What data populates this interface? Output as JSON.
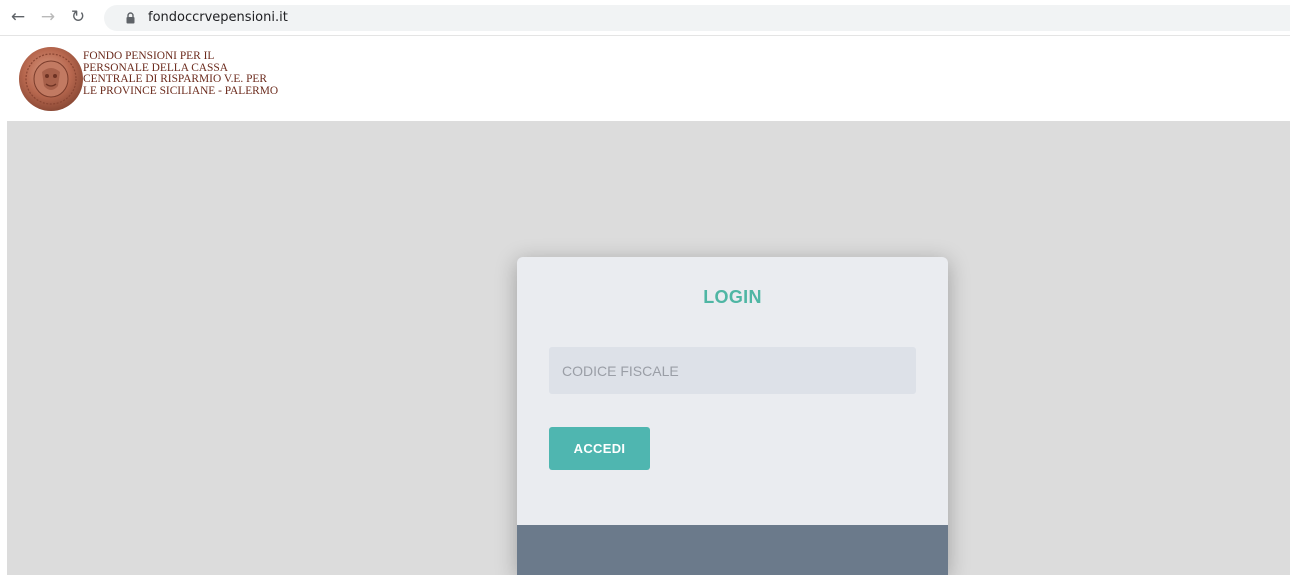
{
  "browser": {
    "url": "fondoccrvepensioni.it",
    "icons": {
      "back": "arrow-left-icon",
      "forward": "arrow-right-icon",
      "reload": "reload-icon",
      "lock": "lock-icon"
    }
  },
  "header": {
    "logo": "seal-logo",
    "org_name_lines": [
      "FONDO PENSIONI  PER IL",
      "PERSONALE DELLA CASSA",
      "CENTRALE DI RISPARMIO V.E. PER",
      "LE PROVINCE SICILIANE - PALERMO"
    ]
  },
  "login": {
    "title": "LOGIN",
    "codice_fiscale": {
      "value": "",
      "placeholder": "CODICE FISCALE"
    },
    "submit_label": "ACCEDI"
  },
  "colors": {
    "accent": "#4fb6a4",
    "button": "#4fb6b0",
    "card_bg": "#eaecf0",
    "footer": "#6b7a8b",
    "page_bg": "#dcdcdc",
    "org_text": "#6b2a1c"
  }
}
